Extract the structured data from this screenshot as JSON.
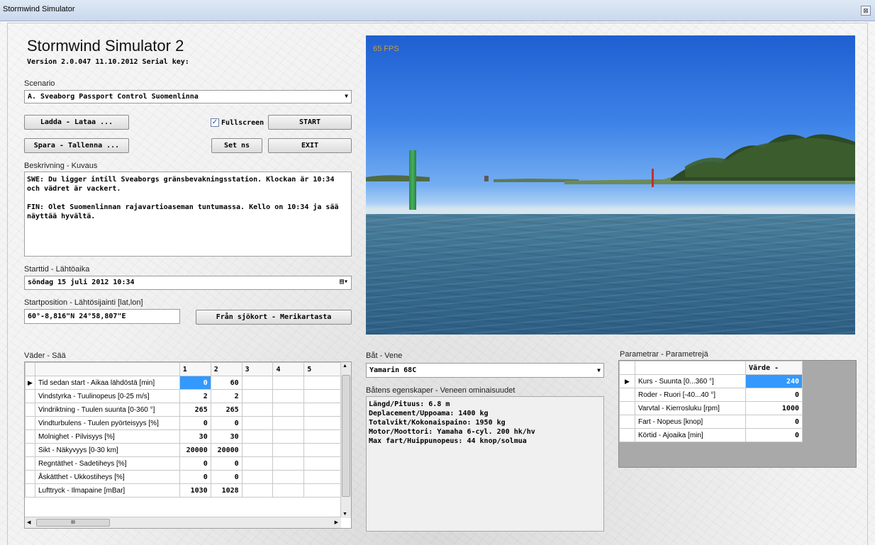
{
  "window": {
    "title": "Stormwind Simulator",
    "close_glyph": "⊠"
  },
  "header": {
    "app_title": "Stormwind Simulator 2",
    "version_line": "Version 2.0.047  11.10.2012   Serial key:"
  },
  "scenario": {
    "label": "Scenario",
    "selected": "A. Sveaborg Passport Control Suomenlinna"
  },
  "buttons": {
    "load": "Ladda - Lataa ...",
    "save": "Spara - Tallenna ...",
    "fullscreen_label": "Fullscreen",
    "fullscreen_checked": true,
    "start": "START",
    "set_ns": "Set ns",
    "exit": "EXIT",
    "from_chart": "Från sjökort - Merikartasta"
  },
  "description": {
    "label": "Beskrivning - Kuvaus",
    "swe": "SWE: Du ligger intill Sveaborgs gränsbevakningsstation. Klockan är 10:34 och vädret är vackert.",
    "fin": "FIN: Olet Suomenlinnan rajavartioaseman tuntumassa. Kello on 10:34 ja sää näyttää hyvältä."
  },
  "start_time": {
    "label": "Starttid - Lähtöaika",
    "value": "söndag 15    juli    2012 10:34"
  },
  "start_position": {
    "label": "Startposition - Lähtösijainti [lat,lon]",
    "value": "60°-8,816\"N 24°58,807\"E"
  },
  "viewport": {
    "fps": "65 FPS"
  },
  "weather": {
    "label": "Väder - Sää",
    "columns": [
      "1",
      "2",
      "3",
      "4",
      "5"
    ],
    "rows": [
      {
        "name": "Tid sedan start - Aikaa lähdöstä [min]",
        "v1": "0",
        "v2": "60",
        "selected": true
      },
      {
        "name": "Vindstyrka - Tuulinopeus [0-25 m/s]",
        "v1": "2",
        "v2": "2"
      },
      {
        "name": "Vindriktning - Tuulen suunta [0-360 °]",
        "v1": "265",
        "v2": "265"
      },
      {
        "name": "Vindturbulens - Tuulen pyörteisyys [%]",
        "v1": "0",
        "v2": "0"
      },
      {
        "name": "Molnighet - Pilvisyys [%]",
        "v1": "30",
        "v2": "30"
      },
      {
        "name": "Sikt - Näkyvyys [0-30 km]",
        "v1": "20000",
        "v2": "20000"
      },
      {
        "name": "Regntäthet - Sadetiheys [%]",
        "v1": "0",
        "v2": "0"
      },
      {
        "name": "Åskätthet - Ukkostiheys [%]",
        "v1": "0",
        "v2": "0"
      },
      {
        "name": "Lufttryck - Ilmapaine [mBar]",
        "v1": "1030",
        "v2": "1028"
      }
    ],
    "hscroll_thumb": "III"
  },
  "boat": {
    "label": "Båt - Vene",
    "selected": "Yamarin 68C",
    "props_label": "Båtens egenskaper - Veneen ominaisuudet",
    "props": [
      "Längd/Pituus: 6.8 m",
      "Deplacement/Uppoama: 1400 kg",
      "Totalvikt/Kokonaispaino: 1950 kg",
      "Motor/Moottori: Yamaha 6-cyl. 200 hk/hv",
      "Max fart/Huippunopeus: 44 knop/solmua"
    ]
  },
  "params": {
    "label": "Parametrar - Parametrejä",
    "column": "Värde -",
    "rows": [
      {
        "name": "Kurs - Suunta [0...360 °]",
        "value": "240",
        "selected": true
      },
      {
        "name": "Roder - Ruori [-40...40 °]",
        "value": "0"
      },
      {
        "name": "Varvtal - Kierrosluku [rpm]",
        "value": "1000"
      },
      {
        "name": "Fart - Nopeus [knop]",
        "value": "0"
      },
      {
        "name": "Körtid - Ajoaika [min]",
        "value": "0"
      }
    ]
  }
}
